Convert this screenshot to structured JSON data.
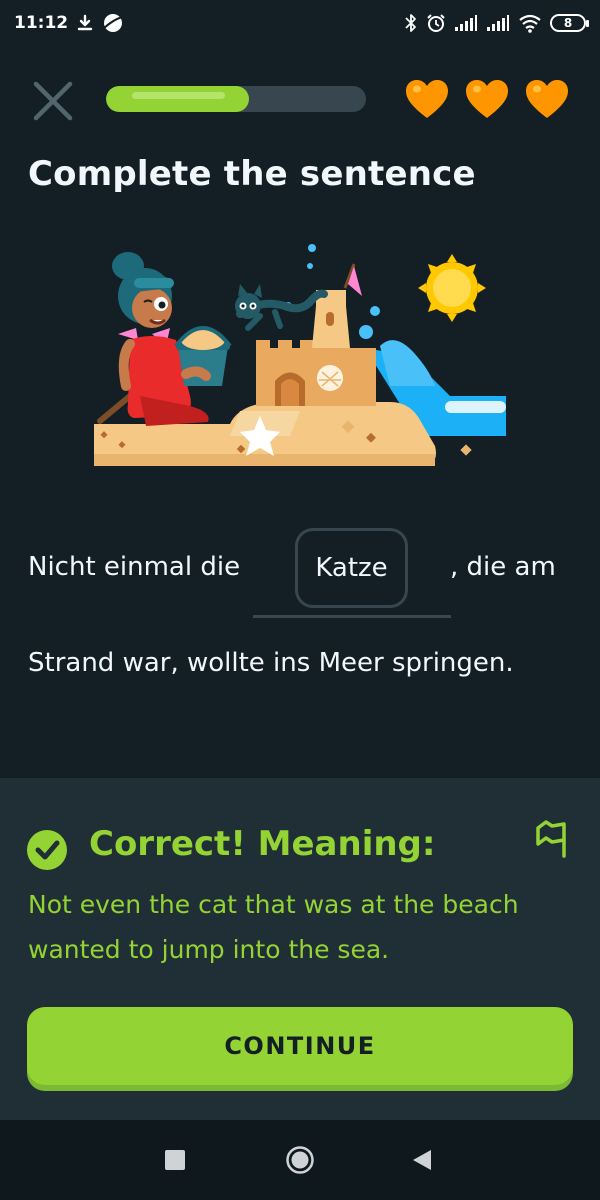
{
  "status_bar": {
    "time": "11:12",
    "battery": "8"
  },
  "lesson": {
    "progress": 0.55,
    "hearts": 3,
    "title": "Complete the sentence"
  },
  "sentence": {
    "line1_before": "Nicht einmal die",
    "answer": "Katze",
    "line1_after": ", die am",
    "line2": "Strand war, wollte ins Meer springen."
  },
  "result": {
    "heading": "Correct! Meaning:",
    "meaning": "Not even the cat that was at the beach wanted to jump into the sea.",
    "continue_label": "CONTINUE"
  },
  "colors": {
    "background": "#131f24",
    "panel": "#202f36",
    "accent_green": "#93d333",
    "heart_orange": "#ff9600",
    "border": "#37464f"
  }
}
